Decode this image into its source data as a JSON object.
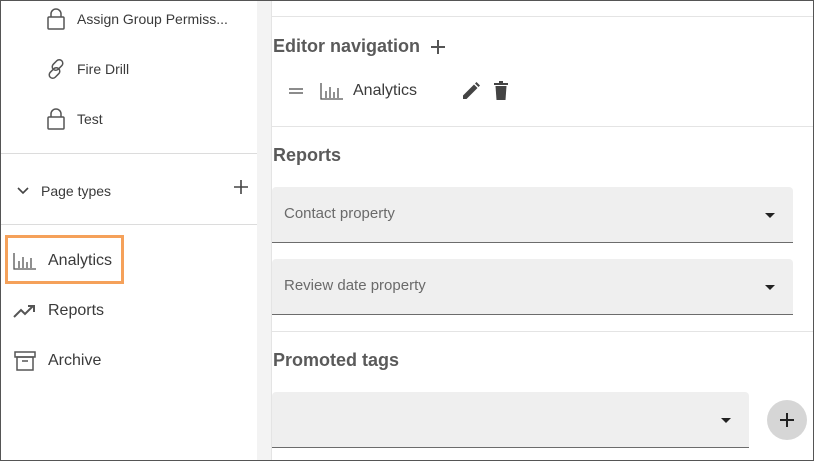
{
  "sidebar": {
    "pages": [
      {
        "label": "Assign Group Permiss...",
        "icon": "lock-icon"
      },
      {
        "label": "Fire Drill",
        "icon": "link-icon"
      },
      {
        "label": "Test",
        "icon": "lock-icon"
      }
    ],
    "page_types": {
      "label": "Page types",
      "expand_icon": "chevron-down-icon",
      "add_icon": "plus-icon"
    },
    "nav": [
      {
        "label": "Analytics",
        "icon": "bar-chart-icon",
        "selected": true
      },
      {
        "label": "Reports",
        "icon": "trending-up-icon"
      },
      {
        "label": "Archive",
        "icon": "archive-icon"
      }
    ],
    "highlight_color": "#f5a15a"
  },
  "main": {
    "editor_navigation": {
      "title": "Editor navigation",
      "items": [
        {
          "label": "Analytics",
          "icon": "bar-chart-icon"
        }
      ]
    },
    "reports": {
      "title": "Reports",
      "contact_property": {
        "placeholder": "Contact property"
      },
      "review_date_property": {
        "placeholder": "Review date property"
      }
    },
    "promoted_tags": {
      "title": "Promoted tags",
      "value": ""
    }
  }
}
